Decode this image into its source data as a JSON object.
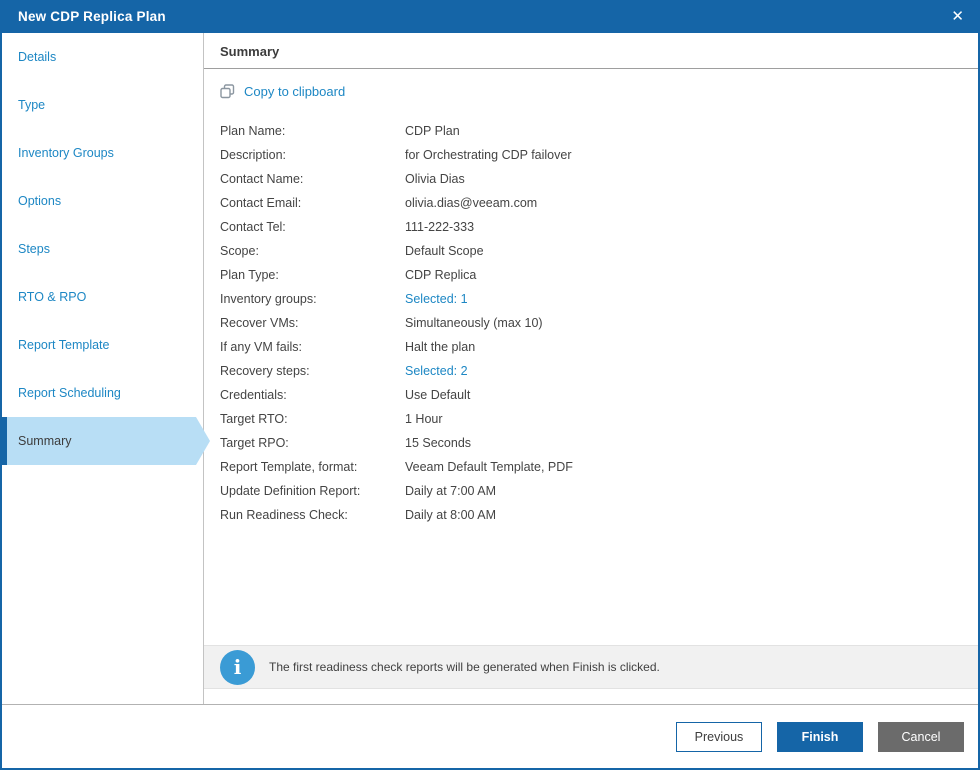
{
  "window": {
    "title": "New CDP Replica Plan",
    "close_glyph": "✕"
  },
  "sidebar": {
    "items": [
      {
        "label": "Details",
        "selected": false
      },
      {
        "label": "Type",
        "selected": false
      },
      {
        "label": "Inventory Groups",
        "selected": false
      },
      {
        "label": "Options",
        "selected": false
      },
      {
        "label": "Steps",
        "selected": false
      },
      {
        "label": "RTO & RPO",
        "selected": false
      },
      {
        "label": "Report Template",
        "selected": false
      },
      {
        "label": "Report Scheduling",
        "selected": false
      },
      {
        "label": "Summary",
        "selected": true
      }
    ]
  },
  "main": {
    "heading": "Summary",
    "copy_label": "Copy to clipboard",
    "rows": [
      {
        "label": "Plan Name:",
        "value": "CDP Plan",
        "link": false
      },
      {
        "label": "Description:",
        "value": "for Orchestrating CDP failover",
        "link": false
      },
      {
        "label": "Contact Name:",
        "value": "Olivia Dias",
        "link": false
      },
      {
        "label": "Contact Email:",
        "value": "olivia.dias@veeam.com",
        "link": false
      },
      {
        "label": "Contact Tel:",
        "value": "111-222-333",
        "link": false
      },
      {
        "label": "Scope:",
        "value": "Default Scope",
        "link": false
      },
      {
        "label": "Plan Type:",
        "value": "CDP Replica",
        "link": false
      },
      {
        "label": "Inventory groups:",
        "value": "Selected: 1",
        "link": true
      },
      {
        "label": "Recover VMs:",
        "value": "Simultaneously (max 10)",
        "link": false
      },
      {
        "label": "If any VM fails:",
        "value": "Halt the plan",
        "link": false
      },
      {
        "label": "Recovery steps:",
        "value": "Selected: 2",
        "link": true
      },
      {
        "label": "Credentials:",
        "value": "Use Default",
        "link": false
      },
      {
        "label": "Target RTO:",
        "value": "1 Hour",
        "link": false
      },
      {
        "label": "Target RPO:",
        "value": "15 Seconds",
        "link": false
      },
      {
        "label": "Report Template, format:",
        "value": "Veeam Default Template, PDF",
        "link": false
      },
      {
        "label": "Update Definition Report:",
        "value": "Daily at 7:00 AM",
        "link": false
      },
      {
        "label": "Run Readiness Check:",
        "value": "Daily at 8:00 AM",
        "link": false
      }
    ],
    "info": {
      "icon_glyph": "i",
      "text": "The first readiness check reports will be generated when Finish is clicked."
    }
  },
  "footer": {
    "buttons": [
      {
        "label": "Previous",
        "style": "secondary"
      },
      {
        "label": "Finish",
        "style": "primary"
      },
      {
        "label": "Cancel",
        "style": "gray"
      }
    ]
  },
  "colors": {
    "accent": "#1565a7",
    "link": "#1d87c4",
    "selected-bg": "#b8def5",
    "info-icon": "#3a9bd5",
    "cancel-bg": "#6b6b6b"
  }
}
